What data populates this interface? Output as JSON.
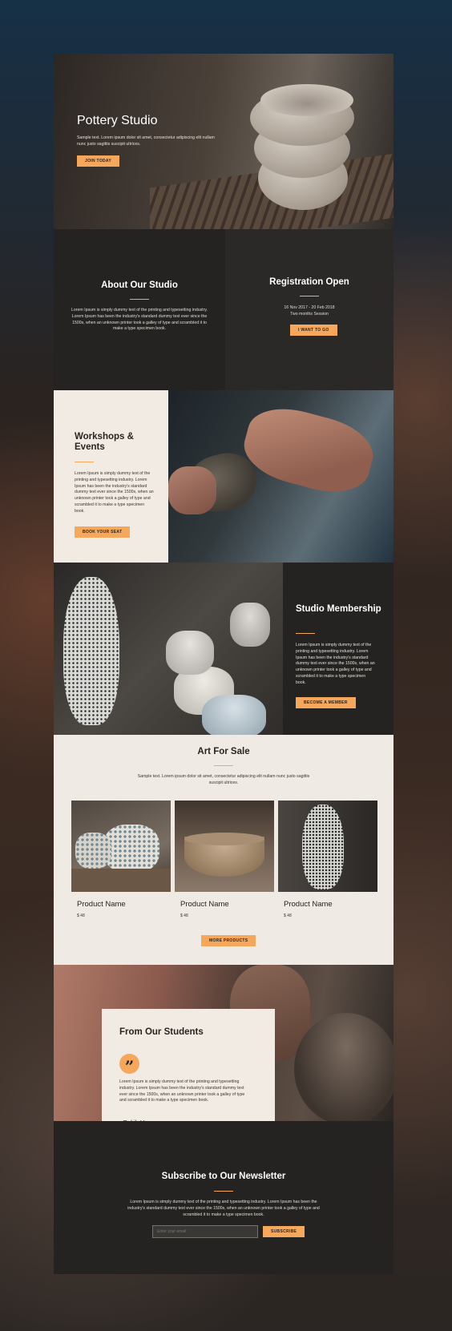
{
  "hero": {
    "title": "Pottery Studio",
    "text": "Sample text. Lorem ipsum dolor sit amet, consectetur adipiscing elit nullam nunc justo sagittis suscipit ultrices.",
    "button": "JOIN TODAY"
  },
  "about": {
    "title": "About Our Studio",
    "text": "Lorem Ipsum is simply dummy text of the printing and typesetting industry. Lorem Ipsum has been the industry's standard dummy text ever since the 1500s, when an unknown printer took a galley of type and scrambled it to make a type specimen book."
  },
  "registration": {
    "title": "Registration Open",
    "dates": "16 Nov 2017 - 20 Feb 2018",
    "session": "Two months Session",
    "button": "I WANT TO GO"
  },
  "workshops": {
    "title": "Workshops & Events",
    "text": "Lorem Ipsum is simply dummy text of the printing and typesetting industry. Lorem Ipsum has been the industry's standard dummy text ever since the 1500s, when an unknown printer took a galley of type and scrambled it to make a type specimen book.",
    "button": "BOOK YOUR SEAT"
  },
  "membership": {
    "title": "Studio Membership",
    "text": "Lorem Ipsum is simply dummy text of the printing and typesetting industry. Lorem Ipsum has been the industry's standard dummy text ever since the 1500s, when an unknown printer took a galley of type and scrambled it to make a type specimen book.",
    "button": "BECOME A MEMBER"
  },
  "sale": {
    "title": "Art For Sale",
    "text": "Sample text. Lorem ipsum dolor sit amet, consectetur adipiscing elit nullam nunc justo sagittis suscipit ultrices.",
    "products": [
      {
        "name": "Product Name",
        "price": "$ 48"
      },
      {
        "name": "Product Name",
        "price": "$ 48"
      },
      {
        "name": "Product Name",
        "price": "$ 48"
      }
    ],
    "button": "MORE PRODUCTS"
  },
  "students": {
    "title": "From Our Students",
    "quote_mark": "”",
    "text": "Lorem Ipsum is simply dummy text of the printing and typesetting industry. Lorem Ipsum has been the industry's standard dummy text ever since the 1500s, when an unknown printer took a galley of type and scrambled it to make a type specimen book.",
    "author": "- Rakib Hasan"
  },
  "newsletter": {
    "title": "Subscribe to Our Newsletter",
    "text": "Lorem Ipsum is simply dummy text of the printing and typesetting industry. Lorem Ipsum has been the industry's standard dummy text ever since the 1500s, when an unknown printer took a galley of type and scrambled it to make a type specimen book.",
    "email_placeholder": "Enter your email",
    "button": "SUBSCRIBE"
  },
  "colors": {
    "accent": "#f5a75b",
    "dark": "#242322",
    "light": "#f1ebe4"
  }
}
